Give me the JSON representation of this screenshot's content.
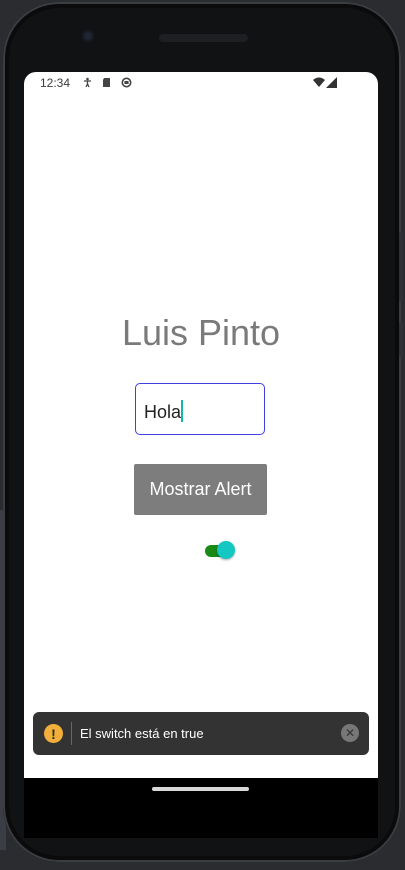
{
  "status_bar": {
    "time": "12:34"
  },
  "main": {
    "title": "Luis Pinto",
    "input_value": "Hola",
    "button_label": "Mostrar Alert"
  },
  "switch": {
    "on": true
  },
  "toast": {
    "message": "El switch está en true",
    "icon_label": "!",
    "close_label": "✕"
  },
  "colors": {
    "accent": "#13c8c2",
    "input_border": "#3f3fe0"
  }
}
